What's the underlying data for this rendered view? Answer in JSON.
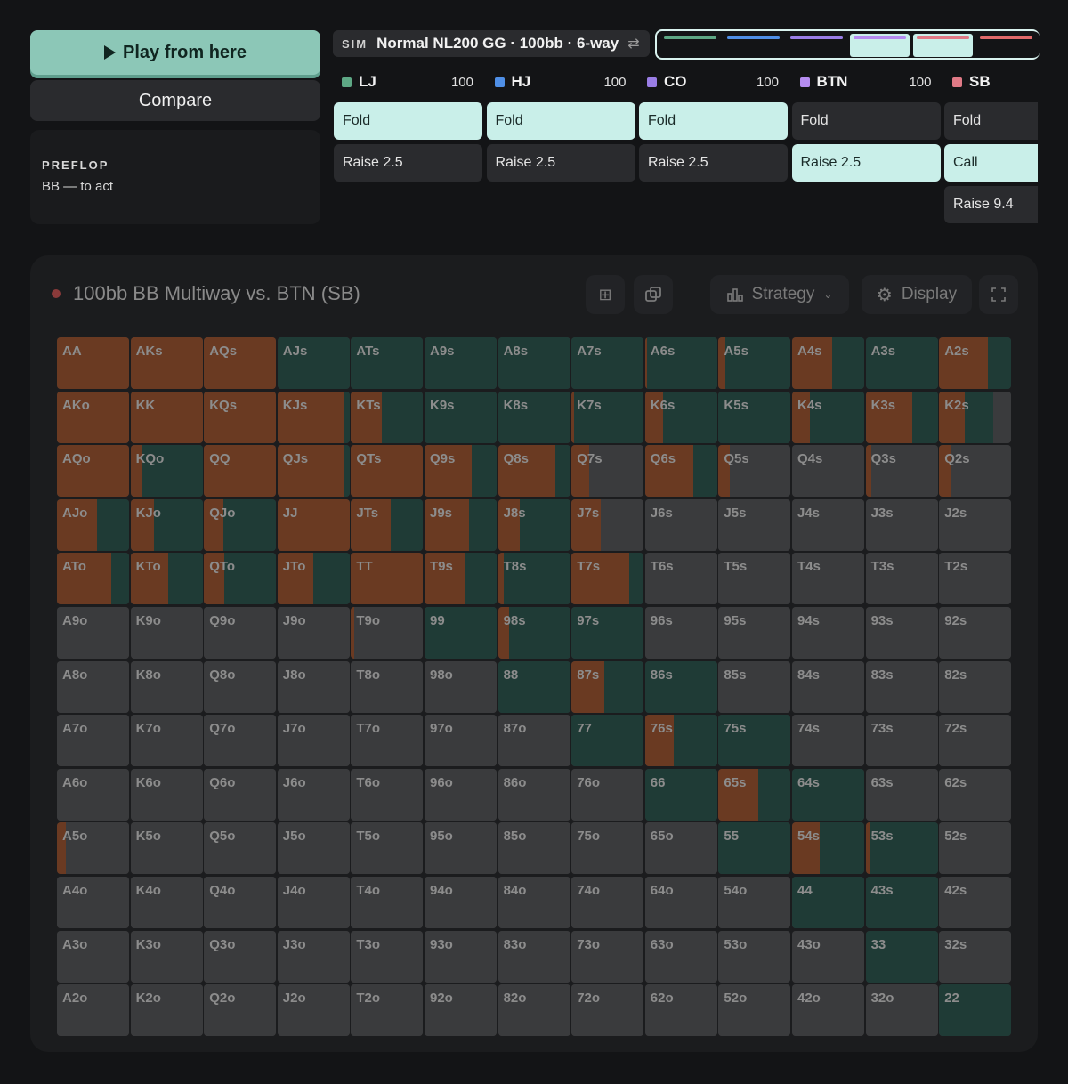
{
  "left": {
    "play_label": "Play from here",
    "compare_label": "Compare",
    "street": "PREFLOP",
    "to_act": "BB — to act"
  },
  "sim": {
    "tag": "SIM",
    "title": "Normal NL200 GG · 100bb · 6-way",
    "swap_icon": "⇄"
  },
  "progress": [
    {
      "color": "#5ea885",
      "filled": false
    },
    {
      "color": "#4f8fe6",
      "filled": false
    },
    {
      "color": "#9a7ee6",
      "filled": false
    },
    {
      "color": "#b58cf0",
      "filled": true
    },
    {
      "color": "#e07a86",
      "filled": true
    },
    {
      "color": "#e06a6a",
      "filled": false
    }
  ],
  "players": [
    {
      "pos": "LJ",
      "stack": "100",
      "color": "#5ea885",
      "actions": [
        {
          "label": "Fold",
          "sel": true
        },
        {
          "label": "Raise 2.5",
          "sel": false
        }
      ]
    },
    {
      "pos": "HJ",
      "stack": "100",
      "color": "#4f8fe6",
      "actions": [
        {
          "label": "Fold",
          "sel": true
        },
        {
          "label": "Raise 2.5",
          "sel": false
        }
      ]
    },
    {
      "pos": "CO",
      "stack": "100",
      "color": "#9a7ee6",
      "actions": [
        {
          "label": "Fold",
          "sel": true
        },
        {
          "label": "Raise 2.5",
          "sel": false
        }
      ]
    },
    {
      "pos": "BTN",
      "stack": "100",
      "color": "#b58cf0",
      "actions": [
        {
          "label": "Fold",
          "sel": false
        },
        {
          "label": "Raise 2.5",
          "sel": true
        }
      ]
    },
    {
      "pos": "SB",
      "stack": "",
      "color": "#e07a86",
      "actions": [
        {
          "label": "Fold",
          "sel": false
        },
        {
          "label": "Call",
          "sel": true
        },
        {
          "label": "Raise 9.4",
          "sel": false
        }
      ]
    }
  ],
  "panel": {
    "title": "100bb BB Multiway vs. BTN (SB)",
    "strategy_label": "Strategy",
    "display_label": "Display"
  },
  "colors": {
    "raise": "#6a3a22",
    "call": "#1f3b36",
    "fold": "#3a3b3d"
  },
  "grid": [
    [
      [
        "AA",
        100,
        0
      ],
      [
        "AKs",
        100,
        0
      ],
      [
        "AQs",
        100,
        0
      ],
      [
        "AJs",
        0,
        100
      ],
      [
        "ATs",
        0,
        100
      ],
      [
        "A9s",
        0,
        100
      ],
      [
        "A8s",
        0,
        100
      ],
      [
        "A7s",
        0,
        100
      ],
      [
        "A6s",
        3,
        97
      ],
      [
        "A5s",
        10,
        90
      ],
      [
        "A4s",
        55,
        45
      ],
      [
        "A3s",
        0,
        100
      ],
      [
        "A2s",
        68,
        32
      ]
    ],
    [
      [
        "AKo",
        100,
        0
      ],
      [
        "KK",
        100,
        0
      ],
      [
        "KQs",
        100,
        0
      ],
      [
        "KJs",
        92,
        8
      ],
      [
        "KTs",
        43,
        57
      ],
      [
        "K9s",
        0,
        100
      ],
      [
        "K8s",
        0,
        100
      ],
      [
        "K7s",
        3,
        97
      ],
      [
        "K6s",
        25,
        75
      ],
      [
        "K5s",
        0,
        100
      ],
      [
        "K4s",
        25,
        75
      ],
      [
        "K3s",
        65,
        35
      ],
      [
        "K2s",
        35,
        40
      ]
    ],
    [
      [
        "AQo",
        100,
        0
      ],
      [
        "KQo",
        17,
        83
      ],
      [
        "QQ",
        100,
        0
      ],
      [
        "QJs",
        92,
        8
      ],
      [
        "QTs",
        100,
        0
      ],
      [
        "Q9s",
        66,
        34
      ],
      [
        "Q8s",
        80,
        20
      ],
      [
        "Q7s",
        25,
        0
      ],
      [
        "Q6s",
        67,
        33
      ],
      [
        "Q5s",
        15,
        0
      ],
      [
        "Q4s",
        0,
        0
      ],
      [
        "Q3s",
        8,
        0
      ],
      [
        "Q2s",
        17,
        0
      ]
    ],
    [
      [
        "AJo",
        55,
        45
      ],
      [
        "KJo",
        33,
        67
      ],
      [
        "QJo",
        27,
        73
      ],
      [
        "JJ",
        100,
        0
      ],
      [
        "JTs",
        55,
        45
      ],
      [
        "J9s",
        62,
        38
      ],
      [
        "J8s",
        30,
        70
      ],
      [
        "J7s",
        40,
        0
      ],
      [
        "J6s",
        0,
        0
      ],
      [
        "J5s",
        0,
        0
      ],
      [
        "J4s",
        0,
        0
      ],
      [
        "J3s",
        0,
        0
      ],
      [
        "J2s",
        0,
        0
      ]
    ],
    [
      [
        "ATo",
        75,
        25
      ],
      [
        "KTo",
        52,
        48
      ],
      [
        "QTo",
        28,
        72
      ],
      [
        "JTo",
        50,
        50
      ],
      [
        "TT",
        100,
        0
      ],
      [
        "T9s",
        57,
        43
      ],
      [
        "T8s",
        8,
        92
      ],
      [
        "T7s",
        80,
        20
      ],
      [
        "T6s",
        0,
        0
      ],
      [
        "T5s",
        0,
        0
      ],
      [
        "T4s",
        0,
        0
      ],
      [
        "T3s",
        0,
        0
      ],
      [
        "T2s",
        0,
        0
      ]
    ],
    [
      [
        "A9o",
        0,
        0
      ],
      [
        "K9o",
        0,
        0
      ],
      [
        "Q9o",
        0,
        0
      ],
      [
        "J9o",
        0,
        0
      ],
      [
        "T9o",
        4,
        0
      ],
      [
        "99",
        0,
        100
      ],
      [
        "98s",
        15,
        85
      ],
      [
        "97s",
        0,
        100
      ],
      [
        "96s",
        0,
        0
      ],
      [
        "95s",
        0,
        0
      ],
      [
        "94s",
        0,
        0
      ],
      [
        "93s",
        0,
        0
      ],
      [
        "92s",
        0,
        0
      ]
    ],
    [
      [
        "A8o",
        0,
        0
      ],
      [
        "K8o",
        0,
        0
      ],
      [
        "Q8o",
        0,
        0
      ],
      [
        "J8o",
        0,
        0
      ],
      [
        "T8o",
        0,
        0
      ],
      [
        "98o",
        0,
        0
      ],
      [
        "88",
        0,
        100
      ],
      [
        "87s",
        45,
        55
      ],
      [
        "86s",
        0,
        100
      ],
      [
        "85s",
        0,
        0
      ],
      [
        "84s",
        0,
        0
      ],
      [
        "83s",
        0,
        0
      ],
      [
        "82s",
        0,
        0
      ]
    ],
    [
      [
        "A7o",
        0,
        0
      ],
      [
        "K7o",
        0,
        0
      ],
      [
        "Q7o",
        0,
        0
      ],
      [
        "J7o",
        0,
        0
      ],
      [
        "T7o",
        0,
        0
      ],
      [
        "97o",
        0,
        0
      ],
      [
        "87o",
        0,
        0
      ],
      [
        "77",
        0,
        100
      ],
      [
        "76s",
        40,
        60
      ],
      [
        "75s",
        0,
        100
      ],
      [
        "74s",
        0,
        0
      ],
      [
        "73s",
        0,
        0
      ],
      [
        "72s",
        0,
        0
      ]
    ],
    [
      [
        "A6o",
        0,
        0
      ],
      [
        "K6o",
        0,
        0
      ],
      [
        "Q6o",
        0,
        0
      ],
      [
        "J6o",
        0,
        0
      ],
      [
        "T6o",
        0,
        0
      ],
      [
        "96o",
        0,
        0
      ],
      [
        "86o",
        0,
        0
      ],
      [
        "76o",
        0,
        0
      ],
      [
        "66",
        0,
        100
      ],
      [
        "65s",
        55,
        45
      ],
      [
        "64s",
        0,
        100
      ],
      [
        "63s",
        0,
        0
      ],
      [
        "62s",
        0,
        0
      ]
    ],
    [
      [
        "A5o",
        12,
        0
      ],
      [
        "K5o",
        0,
        0
      ],
      [
        "Q5o",
        0,
        0
      ],
      [
        "J5o",
        0,
        0
      ],
      [
        "T5o",
        0,
        0
      ],
      [
        "95o",
        0,
        0
      ],
      [
        "85o",
        0,
        0
      ],
      [
        "75o",
        0,
        0
      ],
      [
        "65o",
        0,
        0
      ],
      [
        "55",
        0,
        100
      ],
      [
        "54s",
        38,
        62
      ],
      [
        "53s",
        5,
        95
      ],
      [
        "52s",
        0,
        0
      ]
    ],
    [
      [
        "A4o",
        0,
        0
      ],
      [
        "K4o",
        0,
        0
      ],
      [
        "Q4o",
        0,
        0
      ],
      [
        "J4o",
        0,
        0
      ],
      [
        "T4o",
        0,
        0
      ],
      [
        "94o",
        0,
        0
      ],
      [
        "84o",
        0,
        0
      ],
      [
        "74o",
        0,
        0
      ],
      [
        "64o",
        0,
        0
      ],
      [
        "54o",
        0,
        0
      ],
      [
        "44",
        0,
        100
      ],
      [
        "43s",
        0,
        100
      ],
      [
        "42s",
        0,
        0
      ]
    ],
    [
      [
        "A3o",
        0,
        0
      ],
      [
        "K3o",
        0,
        0
      ],
      [
        "Q3o",
        0,
        0
      ],
      [
        "J3o",
        0,
        0
      ],
      [
        "T3o",
        0,
        0
      ],
      [
        "93o",
        0,
        0
      ],
      [
        "83o",
        0,
        0
      ],
      [
        "73o",
        0,
        0
      ],
      [
        "63o",
        0,
        0
      ],
      [
        "53o",
        0,
        0
      ],
      [
        "43o",
        0,
        0
      ],
      [
        "33",
        0,
        100
      ],
      [
        "32s",
        0,
        0
      ]
    ],
    [
      [
        "A2o",
        0,
        0
      ],
      [
        "K2o",
        0,
        0
      ],
      [
        "Q2o",
        0,
        0
      ],
      [
        "J2o",
        0,
        0
      ],
      [
        "T2o",
        0,
        0
      ],
      [
        "92o",
        0,
        0
      ],
      [
        "82o",
        0,
        0
      ],
      [
        "72o",
        0,
        0
      ],
      [
        "62o",
        0,
        0
      ],
      [
        "52o",
        0,
        0
      ],
      [
        "42o",
        0,
        0
      ],
      [
        "32o",
        0,
        0
      ],
      [
        "22",
        0,
        100
      ]
    ]
  ]
}
